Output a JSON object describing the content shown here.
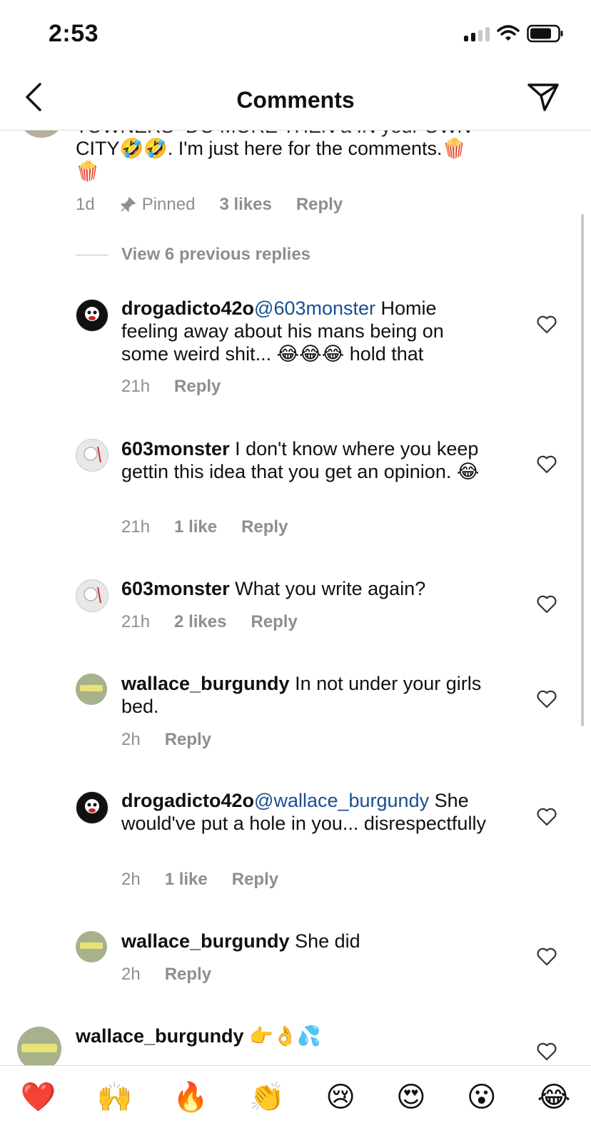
{
  "status_bar": {
    "time": "2:53"
  },
  "header": {
    "title": "Comments"
  },
  "top_comment": {
    "line_cut": "TOWNERS- DO MORE THEN a IN your OWN",
    "line2": "CITY🤣🤣. I'm just here for the comments.🍿",
    "line3": "🍿",
    "meta": {
      "time": "1d",
      "pinned": "Pinned",
      "likes": "3 likes",
      "reply": "Reply"
    }
  },
  "view_previous": "View 6 previous replies",
  "replies": [
    {
      "username": "drogadicto42o",
      "mention": "@603monster",
      "text": " Homie feeling away about his mans being on some weird shit... 😂😂😂 hold that",
      "time": "21h",
      "likes": "",
      "reply": "Reply"
    },
    {
      "username": "603monster",
      "mention": "",
      "text": " I don't know where you keep gettin this idea that you get an opinion. 😂",
      "time": "21h",
      "likes": "1 like",
      "reply": "Reply"
    },
    {
      "username": "603monster",
      "mention": "",
      "text": " What you write again?",
      "time": "21h",
      "likes": "2 likes",
      "reply": "Reply"
    },
    {
      "username": "wallace_burgundy",
      "mention": "",
      "text": " In not under your girls bed.",
      "time": "2h",
      "likes": "",
      "reply": "Reply"
    },
    {
      "username": "drogadicto42o",
      "mention": "@wallace_burgundy",
      "text": " She would've put a hole in you... disrespectfully",
      "time": "2h",
      "likes": "1 like",
      "reply": "Reply"
    },
    {
      "username": "wallace_burgundy",
      "mention": "",
      "text": " She did",
      "time": "2h",
      "likes": "",
      "reply": "Reply"
    }
  ],
  "bottom_comment": {
    "username": "wallace_burgundy",
    "text": " 👉👌💦"
  },
  "emoji_bar": [
    "❤️",
    "🙌",
    "🔥",
    "👏",
    "😢",
    "😍",
    "😮",
    "😂"
  ],
  "icons": {
    "back": "chevron-left-icon",
    "send": "paper-plane-icon",
    "like": "heart-outline-icon",
    "pin": "pin-icon"
  }
}
